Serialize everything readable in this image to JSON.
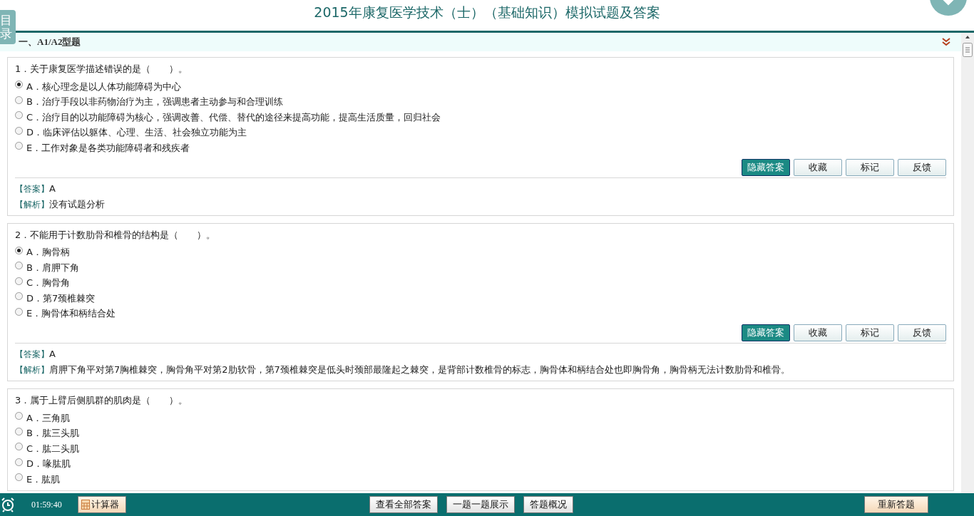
{
  "title": "2015年康复医学技术（士）（基础知识）模拟试题及答案",
  "toc_tab": "目录",
  "section": {
    "title": "一、A1/A2型题"
  },
  "questions": [
    {
      "stem": "1．关于康复医学描述错误的是（　　）。",
      "options": [
        {
          "text": "A．核心理念是以人体功能障碍为中心",
          "selected": true
        },
        {
          "text": "B．治疗手段以非药物治疗为主，强调患者主动参与和合理训练",
          "selected": false
        },
        {
          "text": "C．治疗目的以功能障碍为核心，强调改善、代偿、替代的途径来提高功能，提高生活质量，回归社会",
          "selected": false
        },
        {
          "text": "D．临床评估以躯体、心理、生活、社会独立功能为主",
          "selected": false
        },
        {
          "text": "E．工作对象是各类功能障碍者和残疾者",
          "selected": false
        }
      ],
      "buttons": [
        {
          "label": "隐藏答案",
          "active": true
        },
        {
          "label": "收藏",
          "active": false
        },
        {
          "label": "标记",
          "active": false
        },
        {
          "label": "反馈",
          "active": false
        }
      ],
      "answer_label": "【答案】",
      "answer": "A",
      "analysis_label": "【解析】",
      "analysis": "没有试题分析"
    },
    {
      "stem": "2．不能用于计数肋骨和椎骨的结构是（　　）。",
      "options": [
        {
          "text": "A．胸骨柄",
          "selected": true
        },
        {
          "text": "B．肩胛下角",
          "selected": false
        },
        {
          "text": "C．胸骨角",
          "selected": false
        },
        {
          "text": "D．第7颈椎棘突",
          "selected": false
        },
        {
          "text": "E．胸骨体和柄结合处",
          "selected": false
        }
      ],
      "buttons": [
        {
          "label": "隐藏答案",
          "active": true
        },
        {
          "label": "收藏",
          "active": false
        },
        {
          "label": "标记",
          "active": false
        },
        {
          "label": "反馈",
          "active": false
        }
      ],
      "answer_label": "【答案】",
      "answer": "A",
      "analysis_label": "【解析】",
      "analysis": "肩胛下角平对第7胸椎棘突，胸骨角平对第2肋软骨，第7颈椎棘突是低头时颈部最隆起之棘突，是背部计数椎骨的标志，胸骨体和柄结合处也即胸骨角，胸骨柄无法计数肋骨和椎骨。"
    },
    {
      "stem": "3．属于上臂后侧肌群的肌肉是（　　）。",
      "options": [
        {
          "text": "A．三角肌",
          "selected": false
        },
        {
          "text": "B．肱三头肌",
          "selected": false
        },
        {
          "text": "C．肱二头肌",
          "selected": false
        },
        {
          "text": "D．喙肱肌",
          "selected": false
        },
        {
          "text": "E．肱肌",
          "selected": false
        }
      ]
    }
  ],
  "bottom_bar": {
    "timer": "01:59:40",
    "calculator": "计算器",
    "center_buttons": [
      "查看全部答案",
      "一题一题展示",
      "答题概况"
    ],
    "right_button": "重新答题"
  }
}
